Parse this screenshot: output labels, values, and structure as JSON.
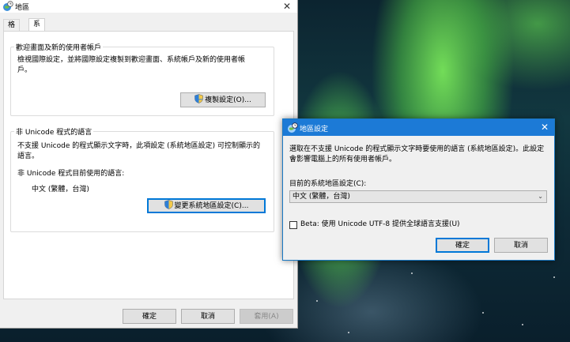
{
  "main_window": {
    "title": "地區",
    "close": "✕",
    "tabs": [
      {
        "label": "格式"
      },
      {
        "label": "系統管理"
      }
    ],
    "welcome_group": {
      "title": "歡迎畫面及新的使用者帳戶",
      "desc_line1": "檢視國際設定，並將國際設定複製到歡迎畫面、系統帳戶及新的使用者帳",
      "desc_line2": "戶。",
      "copy_button": "複製設定(O)..."
    },
    "unicode_group": {
      "title": "非 Unicode 程式的語言",
      "desc_line1": "不支援 Unicode 的程式顯示文字時，此項設定 (系統地區設定) 可控制顯示的",
      "desc_line2": "語言。",
      "current_label": "非 Unicode 程式目前使用的語言:",
      "current_value": "中文 (繁體，台灣)",
      "change_button": "變更系統地區設定(C)..."
    },
    "footer": {
      "ok": "確定",
      "cancel": "取消",
      "apply": "套用(A)"
    }
  },
  "dialog": {
    "title": "地區設定",
    "close": "✕",
    "desc_line1": "選取在不支援 Unicode 的程式顯示文字時要使用的語言 (系統地區設定)。此設定",
    "desc_line2": "會影響電腦上的所有使用者帳戶。",
    "locale_label": "目前的系統地區設定(C):",
    "locale_value": "中文 (繁體，台灣)",
    "beta_label": "Beta: 使用 Unicode UTF-8 提供全球語言支援(U)",
    "beta_checked": false,
    "ok": "確定",
    "cancel": "取消"
  },
  "colors": {
    "accent": "#1c7ad6",
    "window_bg": "#f0f0f0"
  },
  "icons": {
    "app": "globe-clock-icon",
    "uac": "uac-shield-icon",
    "dropdown": "chevron-down-icon"
  }
}
